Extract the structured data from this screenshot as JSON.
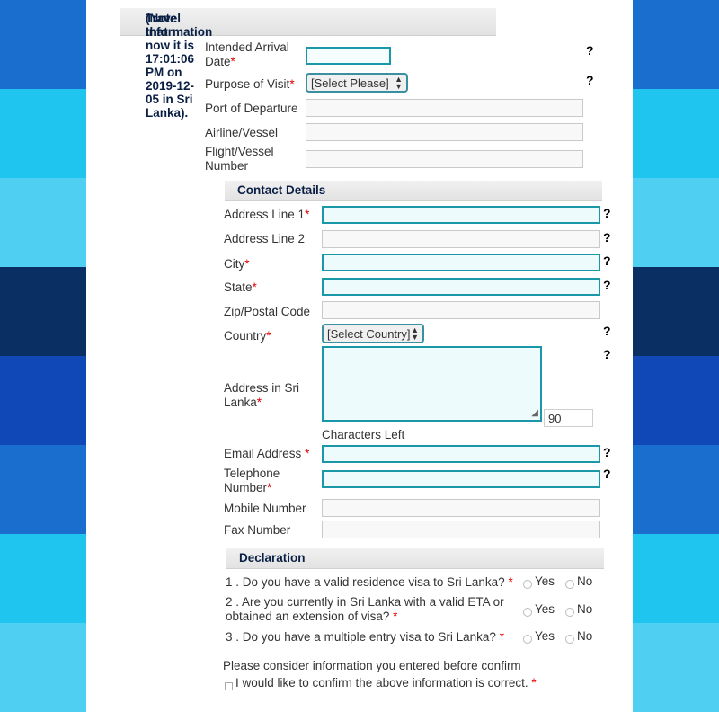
{
  "stripes": [
    "#1a6fce",
    "#1fc4ef",
    "#4fd0f3",
    "#0a2f63",
    "#1048b8",
    "#1a6fce",
    "#1fc4ef",
    "#4fd0f3"
  ],
  "travel": {
    "header": "Travel Information",
    "note": "(Note that now it is 17:01:06 PM on 2019-12-05 in Sri Lanka).",
    "arrival_label": "Intended Arrival Date",
    "purpose_label": "Purpose of Visit",
    "purpose_value": "[Select Please]",
    "departure_label": "Port of Departure",
    "airline_label": "Airline/Vessel",
    "flight_label": "Flight/Vessel Number"
  },
  "contact": {
    "header": "Contact Details",
    "address1_label": "Address Line 1",
    "address2_label": "Address Line 2",
    "city_label": "City",
    "state_label": "State",
    "zip_label": "Zip/Postal Code",
    "country_label": "Country",
    "country_value": "[Select Country]",
    "sl_address_label": "Address in Sri Lanka",
    "chars_left_value": "90",
    "chars_left_label": "Characters Left",
    "email_label": "Email Address",
    "telephone_label": "Telephone Number",
    "mobile_label": "Mobile Number",
    "fax_label": "Fax Number"
  },
  "declaration": {
    "header": "Declaration",
    "q1": "1 . Do you have a valid residence visa to Sri Lanka?",
    "q2": "2 . Are you currently in Sri Lanka with a valid ETA or obtained an extension of visa?",
    "q3": "3 . Do you have a multiple entry visa to Sri Lanka?",
    "yes": "Yes",
    "no": "No",
    "consider": "Please consider information you entered before confirm",
    "confirm": "I would like to confirm the above information is correct."
  },
  "common": {
    "required_mark": "*",
    "help_mark": "?"
  }
}
